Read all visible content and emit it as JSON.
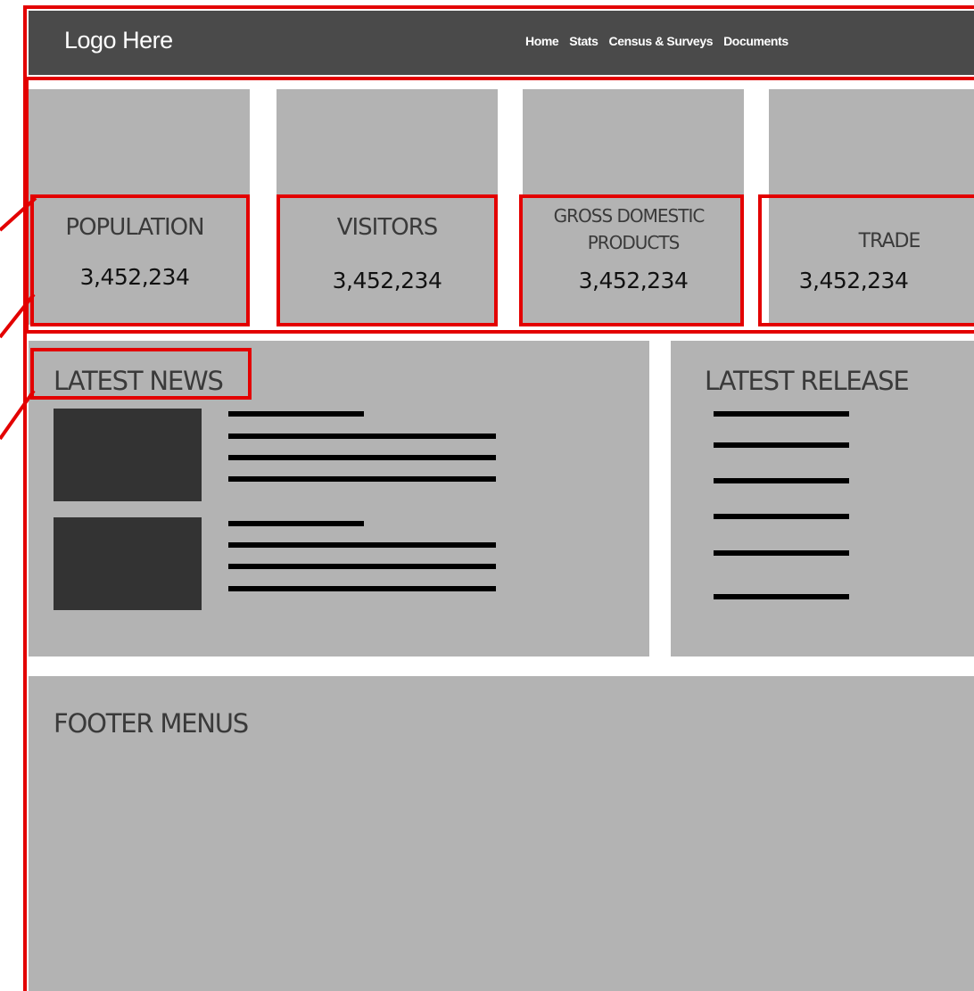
{
  "header": {
    "logo": "Logo Here",
    "nav": [
      "Home",
      "Stats",
      "Census & Surveys",
      "Documents"
    ]
  },
  "stats": [
    {
      "label": "POPULATION",
      "value": "3,452,234"
    },
    {
      "label": "VISITORS",
      "value": "3,452,234"
    },
    {
      "label": "GROSS DOMESTIC PRODUCTS",
      "label_line1": "GROSS DOMESTIC",
      "label_line2": "PRODUCTS",
      "value": "3,452,234"
    },
    {
      "label": "TRADE",
      "value": "3,452,234"
    }
  ],
  "news": {
    "title": "LATEST NEWS",
    "items": [
      {
        "thumbnail": "image-placeholder"
      },
      {
        "thumbnail": "image-placeholder"
      }
    ]
  },
  "release": {
    "title": "LATEST RELEASE",
    "item_count": 6
  },
  "footer": {
    "title": "FOOTER MENUS"
  },
  "colors": {
    "navbar": "#4a4a4a",
    "panel": "#b3b3b3",
    "highlight": "#e30000",
    "thumbnail": "#333333"
  }
}
